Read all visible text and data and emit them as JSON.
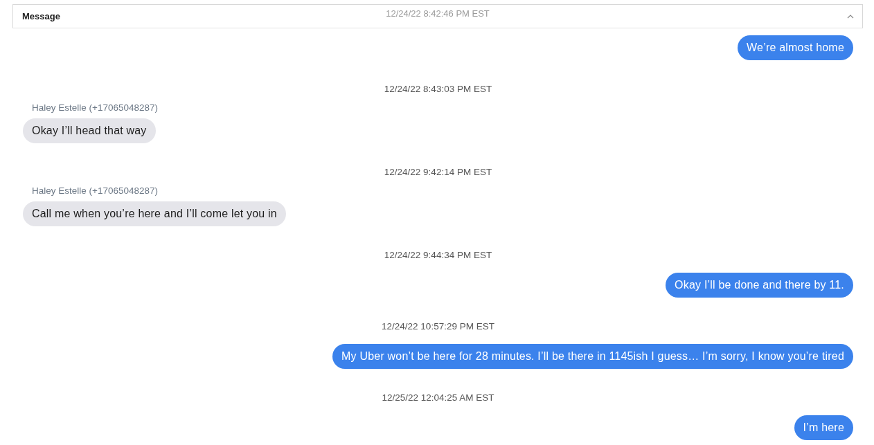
{
  "header": {
    "title": "Message",
    "faded_timestamp": "12/24/22 8:42:46 PM EST"
  },
  "messages": [
    {
      "kind": "sent",
      "text": "We’re almost home"
    },
    {
      "kind": "timestamp",
      "text": "12/24/22 8:43:03 PM EST"
    },
    {
      "kind": "received",
      "sender": "Haley Estelle (+17065048287)",
      "text": "Okay I’ll head that way"
    },
    {
      "kind": "timestamp",
      "text": "12/24/22 9:42:14 PM EST"
    },
    {
      "kind": "received",
      "sender": "Haley Estelle (+17065048287)",
      "text": "Call me when you’re here and I’ll come let you in"
    },
    {
      "kind": "timestamp",
      "text": "12/24/22 9:44:34 PM EST"
    },
    {
      "kind": "sent",
      "text": "Okay I’ll be done and there by 11."
    },
    {
      "kind": "timestamp",
      "text": "12/24/22 10:57:29 PM EST"
    },
    {
      "kind": "sent",
      "text": "My Uber won’t be here for 28 minutes. I’ll be there in 1145ish I guess… I’m sorry, I know you’re tired"
    },
    {
      "kind": "timestamp",
      "text": "12/25/22 12:04:25 AM EST"
    },
    {
      "kind": "sent",
      "text": "I’m here"
    }
  ]
}
